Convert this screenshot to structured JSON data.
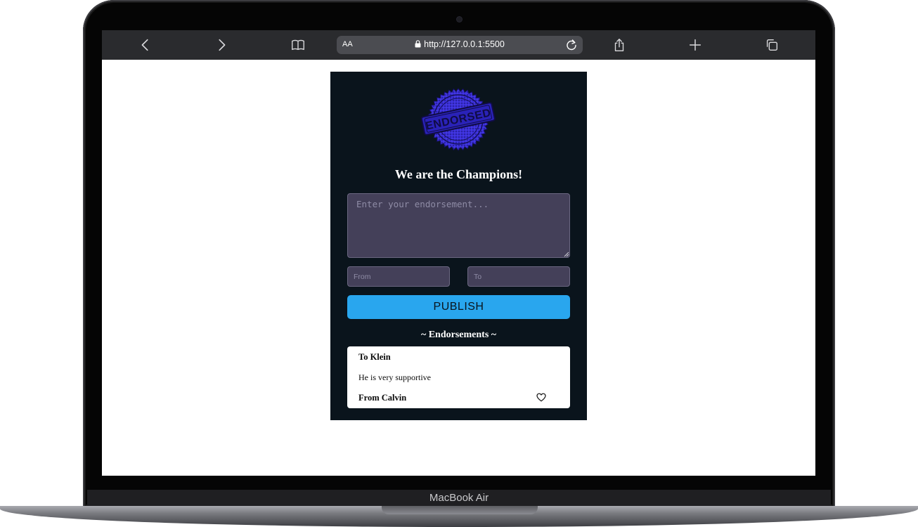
{
  "device": {
    "label": "MacBook Air"
  },
  "browser": {
    "text_size_label": "AA",
    "url": "http://127.0.0.1:5500",
    "icons": [
      "back-icon",
      "forward-icon",
      "bookmarks-icon",
      "lock-icon",
      "reload-icon",
      "share-icon",
      "new-tab-icon",
      "tabs-icon"
    ]
  },
  "app": {
    "logo_text": "ENDORSED",
    "title": "We are the Champions!",
    "endorsement_placeholder": "Enter your endorsement...",
    "from_placeholder": "From",
    "to_placeholder": "To",
    "publish_label": "PUBLISH",
    "list_heading": "~ Endorsements ~",
    "colors": {
      "background": "#0a141c",
      "input": "#444059",
      "button": "#29a6ee",
      "stamp": "#3a2fd8"
    },
    "endorsements": [
      {
        "to": "To Klein",
        "message": "He is very supportive",
        "from": "From Calvin",
        "icon": "heart-outline-icon"
      }
    ]
  }
}
